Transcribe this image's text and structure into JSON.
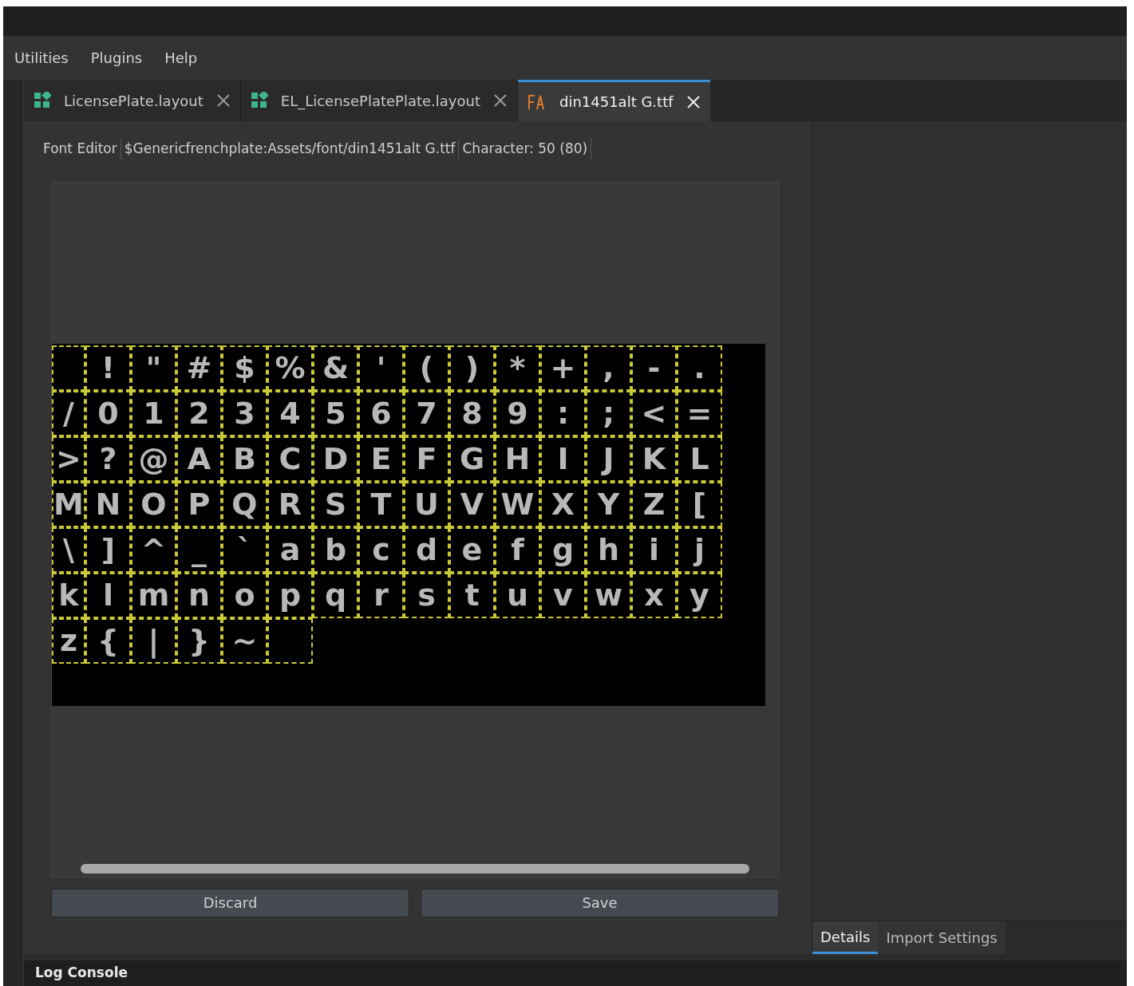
{
  "menu": [
    {
      "label": "Utilities"
    },
    {
      "label": "Plugins"
    },
    {
      "label": "Help"
    }
  ],
  "tabs": [
    {
      "label": "LicensePlate.layout",
      "kind": "layout",
      "selected": false
    },
    {
      "label": "EL_LicensePlatePlate.layout",
      "kind": "layout",
      "selected": false
    },
    {
      "label": "din1451alt G.ttf",
      "kind": "font",
      "selected": true
    }
  ],
  "breadcrumb": [
    "Font Editor",
    "$Genericfrenchplate:Assets/font/din1451alt G.ttf",
    "Character: 50 (80)"
  ],
  "glyph_rows": [
    [
      null,
      "!",
      "\"",
      "#",
      "$",
      "%",
      "&",
      "'",
      "(",
      ")",
      "*",
      "+",
      ",",
      "-",
      "."
    ],
    [
      "/",
      "0",
      "1",
      "2",
      "3",
      "4",
      "5",
      "6",
      "7",
      "8",
      "9",
      ":",
      ";",
      "<",
      "="
    ],
    [
      ">",
      "?",
      "@",
      "A",
      "B",
      "C",
      "D",
      "E",
      "F",
      "G",
      "H",
      "I",
      "J",
      "K",
      "L"
    ],
    [
      "M",
      "N",
      "O",
      "P",
      "Q",
      "R",
      "S",
      "T",
      "U",
      "V",
      "W",
      "X",
      "Y",
      "Z",
      "["
    ],
    [
      "\\",
      "]",
      "^",
      "_",
      "`",
      "a",
      "b",
      "c",
      "d",
      "e",
      "f",
      "g",
      "h",
      "i",
      "j"
    ],
    [
      "k",
      "l",
      "m",
      "n",
      "o",
      "p",
      "q",
      "r",
      "s",
      "t",
      "u",
      "v",
      "w",
      "x",
      "y"
    ],
    [
      "z",
      "{",
      "|",
      "}",
      "~",
      null
    ]
  ],
  "buttons": [
    {
      "label": "Discard"
    },
    {
      "label": "Save"
    }
  ],
  "side_tabs": [
    {
      "label": "Details",
      "selected": true
    },
    {
      "label": "Import Settings",
      "selected": false
    }
  ],
  "log_console": {
    "title": "Log Console"
  }
}
